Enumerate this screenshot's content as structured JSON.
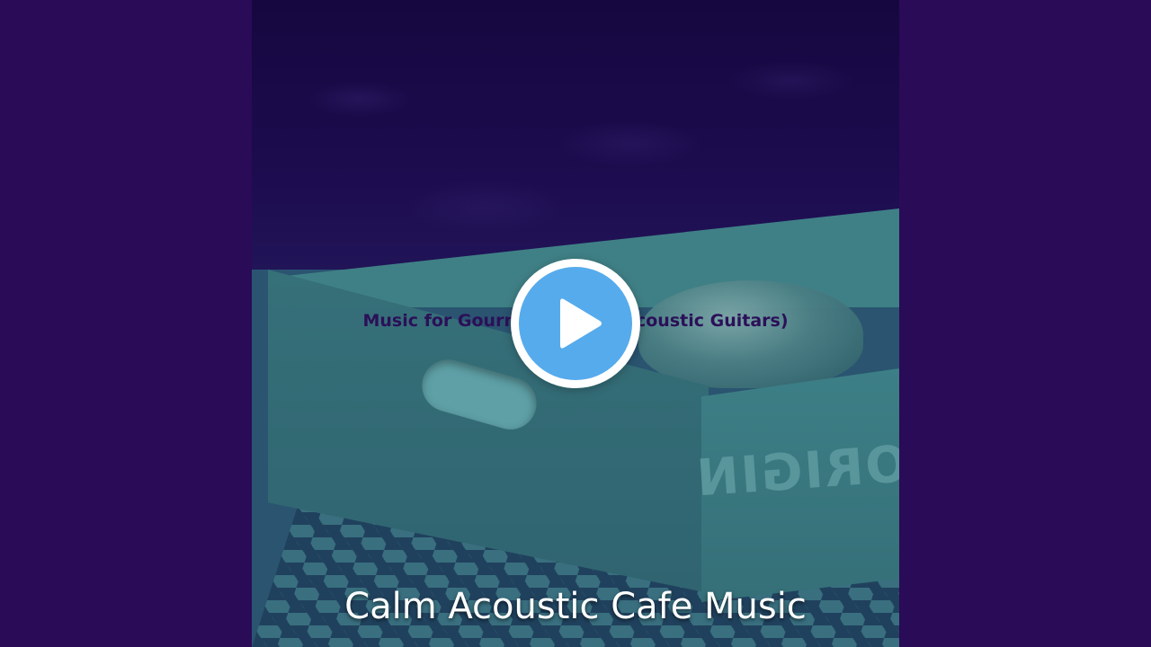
{
  "cover": {
    "title": "Music for Gourmet Coffee (Acoustic Guitars)",
    "stamp": "ORIGIN"
  },
  "player": {
    "play_icon": "play-icon"
  },
  "caption": {
    "text": "Calm Acoustic Cafe Music"
  },
  "colors": {
    "background": "#2a0b58",
    "play_button": "#56abec",
    "caption": "#ffffff"
  }
}
